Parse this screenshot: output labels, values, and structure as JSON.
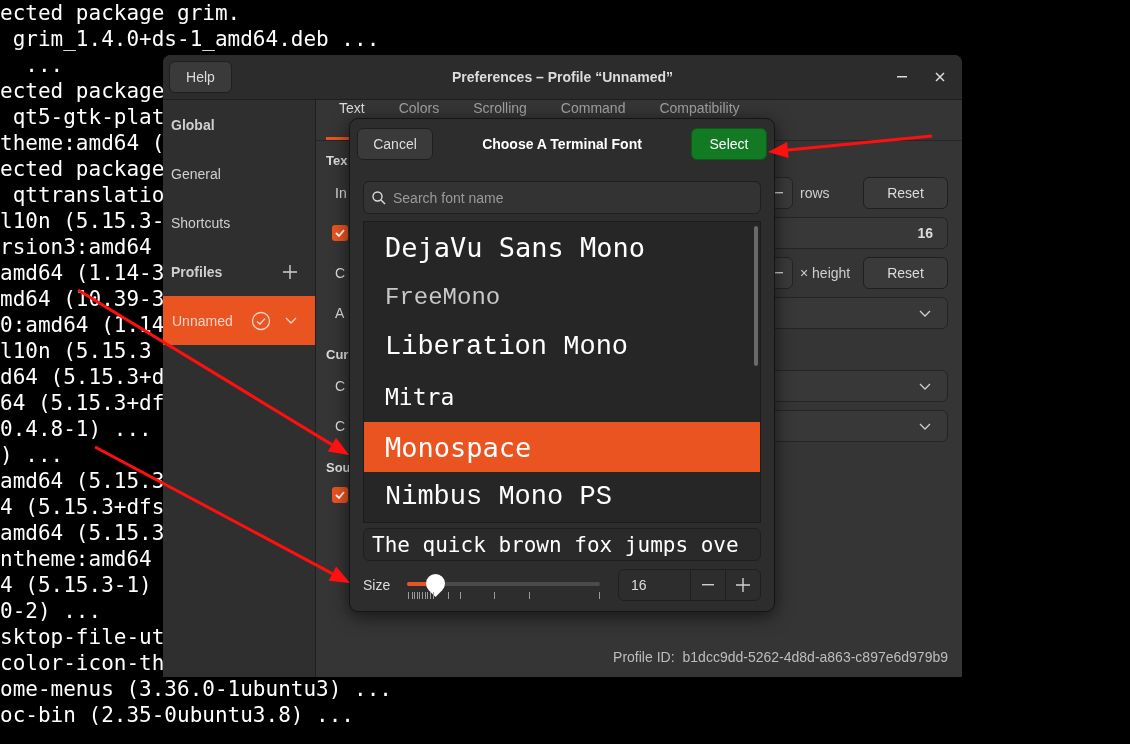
{
  "terminal": {
    "lines": [
      "ected package grim.",
      " grim_1.4.0+ds-1_amd64.deb ...",
      "  ...",
      "ected package",
      " qt5-gtk-plat",
      "theme:amd64 (",
      "ected package",
      " qttranslatio",
      "l10n (5.15.3-",
      "rsion3:amd64",
      "amd64 (1.14-3",
      "md64 (10.39-3",
      "0:amd64 (1.14",
      "l10n (5.15.3",
      "d64 (5.15.3+d",
      "64 (5.15.3+df",
      "0.4.8-1) ...",
      ") ...",
      "amd64 (5.15.3",
      "4 (5.15.3+dfs",
      "amd64 (5.15.3",
      "ntheme:amd64",
      "4 (5.15.3-1)",
      "0-2) ...",
      "sktop-file-ut",
      "color-icon-th",
      "ome-menus (3.36.0-1ubuntu3) ...",
      "oc-bin (2.35-0ubuntu3.8) ..."
    ]
  },
  "window": {
    "title": "Preferences – Profile “Unnamed”",
    "help_button": "Help",
    "controls": [
      {
        "kind": "minimize"
      },
      {
        "kind": "close"
      }
    ]
  },
  "sidebar": {
    "items": [
      {
        "kind": "heading",
        "label": "Global"
      },
      {
        "kind": "item",
        "label": "General",
        "selected": false
      },
      {
        "kind": "item",
        "label": "Shortcuts",
        "selected": false
      },
      {
        "kind": "heading",
        "label": "Profiles",
        "add": true
      },
      {
        "kind": "profile",
        "label": "Unnamed",
        "selected": true,
        "default": true
      }
    ]
  },
  "tabs": [
    {
      "label": "Text",
      "selected": true
    },
    {
      "label": "Colors",
      "selected": false
    },
    {
      "label": "Scrolling",
      "selected": false
    },
    {
      "label": "Command",
      "selected": false
    },
    {
      "label": "Compatibility",
      "selected": false
    }
  ],
  "content": {
    "rows": [
      {
        "kind": "heading",
        "label": "Tex"
      },
      {
        "kind": "spin",
        "label": "In",
        "unit": "rows",
        "button": "Reset"
      },
      {
        "kind": "font",
        "checked": true,
        "value": "16"
      },
      {
        "kind": "spin",
        "label": "C",
        "unit": "× height",
        "button": "Reset"
      },
      {
        "kind": "dropdown",
        "label": "A"
      },
      {
        "kind": "heading",
        "label": "Cur"
      },
      {
        "kind": "dropdown",
        "label": "C"
      },
      {
        "kind": "dropdown",
        "label": "C"
      },
      {
        "kind": "heading",
        "label": "Sou"
      },
      {
        "kind": "checkbox",
        "checked": true
      }
    ]
  },
  "profile_id": {
    "label": "Profile ID:",
    "value": "b1dcc9dd-5262-4d8d-a863-c897e6d979b9"
  },
  "dialog": {
    "title": "Choose A Terminal Font",
    "cancel": "Cancel",
    "select": "Select",
    "search": {
      "placeholder": "Search font name"
    },
    "fonts": [
      {
        "name": "DejaVu Sans Mono",
        "kind": "dejavu",
        "selected": false
      },
      {
        "name": "FreeMono",
        "kind": "freemono",
        "selected": false
      },
      {
        "name": "Liberation Mono",
        "kind": "liberation",
        "selected": false
      },
      {
        "name": "Mitra",
        "kind": "mitra",
        "selected": false
      },
      {
        "name": "Monospace",
        "kind": "monospace",
        "selected": true
      },
      {
        "name": "Nimbus Mono PS",
        "kind": "nimbus",
        "selected": false
      }
    ],
    "preview": "The quick brown fox jumps ove",
    "size": {
      "label": "Size",
      "level": 0.15,
      "value": "16"
    }
  },
  "annotations": [
    {
      "kind": "arrow"
    },
    {
      "kind": "arrow"
    },
    {
      "kind": "arrow"
    }
  ]
}
